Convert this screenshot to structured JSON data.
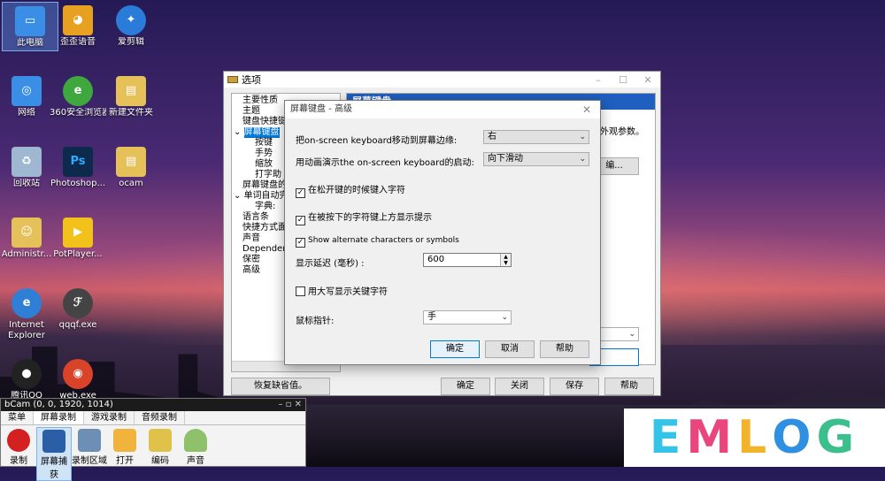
{
  "desktop_icons": [
    {
      "label": "此电脑",
      "color": "#3a8ee6"
    },
    {
      "label": "歪歪语音",
      "color": "#e8a020"
    },
    {
      "label": "爱剪辑",
      "color": "#2b7bd8"
    },
    {
      "label": "网络",
      "color": "#3a8ee6"
    },
    {
      "label": "360安全浏览器",
      "color": "#3ea83e"
    },
    {
      "label": "新建文件夹",
      "color": "#e6c15a"
    },
    {
      "label": "回收站",
      "color": "#9fb7d0"
    },
    {
      "label": "Photoshop...",
      "color": "#0d2a4d"
    },
    {
      "label": "ocam",
      "color": "#e6c15a"
    },
    {
      "label": "Administr...",
      "color": "#e6c15a"
    },
    {
      "label": "PotPlayer...",
      "color": "#f2c21b"
    },
    {
      "label": "Internet Explorer",
      "color": "#2f7fd6"
    },
    {
      "label": "qqqf.exe",
      "color": "#444"
    },
    {
      "label": "腾讯QQ",
      "color": "#222"
    },
    {
      "label": "web.exe",
      "color": "#d9432a"
    }
  ],
  "options_window": {
    "title": "选项",
    "tree": [
      "主要性质",
      "主题",
      "键盘快捷键",
      "屏幕键盘",
      "按键",
      "手势",
      "缩放",
      "打字助",
      "屏幕键盘的",
      "单词自动完",
      "字典:",
      "语言条",
      "快捷方式面",
      "声音",
      "Dependenc",
      "保密",
      "高级"
    ],
    "selected": "屏幕键盘",
    "pane_header": "屏幕键盘",
    "pane_text": "外观参数。",
    "pane_button": "编...",
    "buttons": {
      "restore": "恢复缺省值。",
      "ok": "确定",
      "close": "关闭",
      "save": "保存",
      "help": "帮助"
    }
  },
  "dialog": {
    "title": "屏幕键盘 - 高级",
    "move_label": "把on-screen keyboard移动到屏幕边缘:",
    "move_value": "右",
    "animate_label": "用动画演示the on-screen keyboard的启动:",
    "animate_value": "向下滑动",
    "chk_release": "在松开键的时候键入字符",
    "chk_hint": "在被按下的字符键上方显示提示",
    "chk_alternate": "Show alternate characters or symbols",
    "delay_label": "显示延迟 (毫秒) :",
    "delay_value": "600",
    "chk_caps": "用大写显示关键字符",
    "cursor_label": "鼠标指针:",
    "cursor_value": "手",
    "ok": "确定",
    "cancel": "取消",
    "help": "帮助"
  },
  "ocam": {
    "title": "bCam (0, 0, 1920, 1014)",
    "tabs": [
      "菜单",
      "屏幕录制",
      "游戏录制",
      "音频录制"
    ],
    "tools": [
      "录制",
      "屏幕捕获",
      "录制区域",
      "打开",
      "编码",
      "声音"
    ]
  },
  "logo": {
    "letters": [
      "E",
      "M",
      "L",
      "O",
      "G"
    ],
    "colors": [
      "#36c3e8",
      "#e8467c",
      "#f2b32a",
      "#2f8fe0",
      "#3bbf8c"
    ]
  }
}
